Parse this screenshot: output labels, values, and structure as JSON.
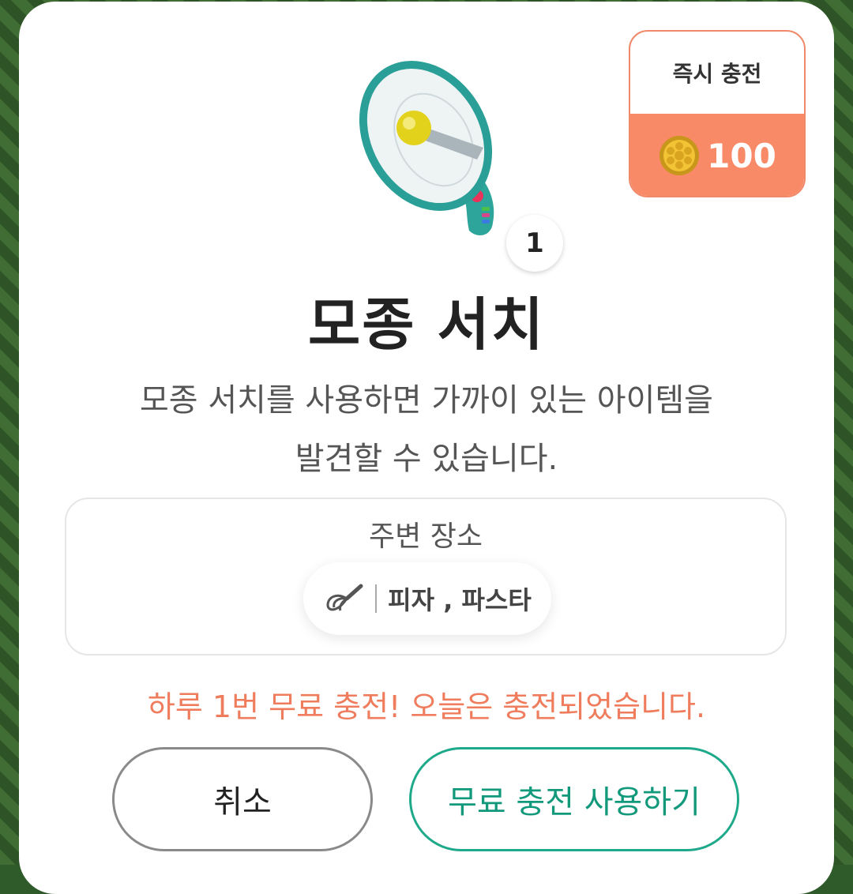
{
  "modal": {
    "instant_charge": {
      "label": "즉시 충전",
      "coin_amount": "100",
      "icon": "coin-icon"
    },
    "item": {
      "icon": "megaphone-icon",
      "count": "1",
      "title": "모종 서치",
      "description_line1": "모종 서치를 사용하면 가까이 있는 아이템을",
      "description_line2": "발견할 수 있습니다."
    },
    "nearby": {
      "title": "주변 장소",
      "place_icon": "whisk-icon",
      "place_text": "피자 , 파스타"
    },
    "notice": "하루 1번 무료 충전! 오늘은 충전되었습니다.",
    "buttons": {
      "cancel": "취소",
      "use_free_charge": "무료 충전 사용하기"
    }
  },
  "colors": {
    "accent_orange": "#f88a68",
    "notice_orange": "#ef7d5d",
    "teal": "#1ea98a"
  }
}
